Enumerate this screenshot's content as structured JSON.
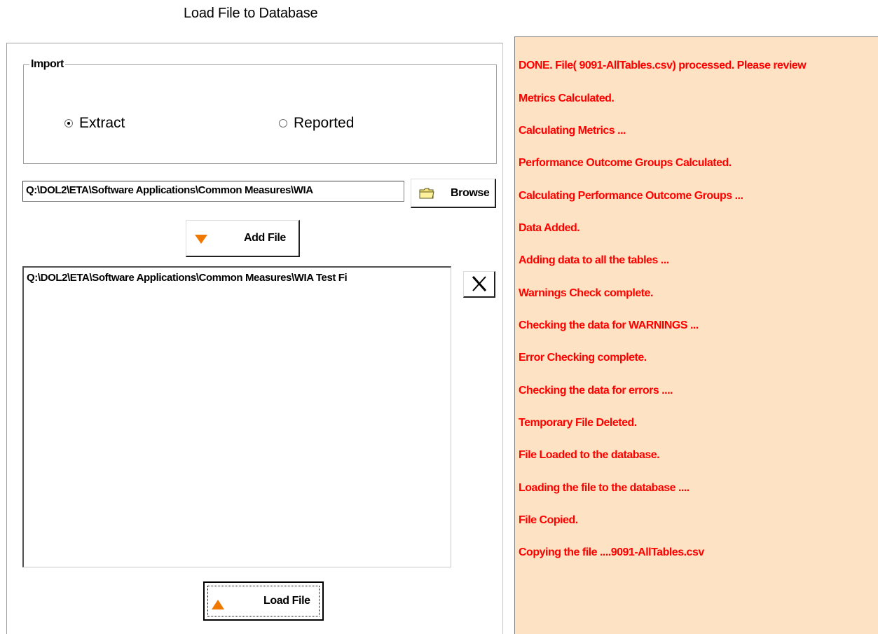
{
  "page": {
    "title": "Load File to Database"
  },
  "import_group": {
    "legend": "Import",
    "options": [
      {
        "label": "Extract",
        "checked": true
      },
      {
        "label": "Reported",
        "checked": false
      }
    ]
  },
  "file_path": {
    "value": "Q:\\DOL2\\ETA\\Software Applications\\Common Measures\\WIA"
  },
  "buttons": {
    "browse": {
      "label": "Browse",
      "icon": "folder-icon"
    },
    "add_file": {
      "label": "Add File",
      "icon": "down-arrow-icon"
    },
    "remove": {
      "icon": "close-icon"
    },
    "load_file": {
      "label": "Load File",
      "icon": "up-arrow-icon"
    }
  },
  "file_list": {
    "items": [
      "Q:\\DOL2\\ETA\\Software Applications\\Common Measures\\WIA Test Fi"
    ]
  },
  "log": {
    "lines": [
      "DONE. File( 9091-AllTables.csv) processed. Please review",
      "Metrics Calculated.",
      "Calculating Metrics ...",
      "Performance Outcome Groups Calculated.",
      "Calculating Performance Outcome Groups ...",
      "Data Added.",
      "Adding data to all the tables ...",
      "Warnings Check complete.",
      "Checking the data for WARNINGS ...",
      "Error Checking complete.",
      "Checking the data for errors ....",
      "Temporary File Deleted.",
      "File Loaded to the database.",
      "Loading the file to the database ....",
      "File Copied.",
      "Copying the file ....9091-AllTables.csv"
    ]
  },
  "colors": {
    "log_background": "#fde2c3",
    "log_text": "#ff0000",
    "arrow_accent": "#f07800"
  }
}
